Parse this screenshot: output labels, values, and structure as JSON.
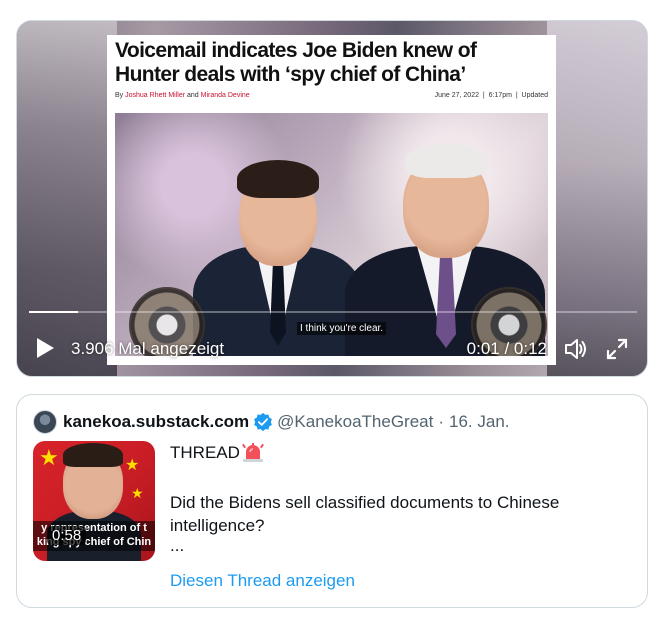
{
  "video": {
    "article": {
      "headline": "Voicemail indicates Joe Biden knew of Hunter deals with ‘spy chief of China’",
      "byline_prefix": "By",
      "author1": "Joshua Rhett Miller",
      "byline_and": "and",
      "author2": "Miranda Devine",
      "dateline": "June 27, 2022  |  6:17pm  |  Updated"
    },
    "caption": "I think you're clear.",
    "views": "3.906 Mal angezeigt",
    "time": "0:01 / 0:12",
    "progress": 0.08,
    "icons": [
      "play-icon",
      "volume-icon",
      "fullscreen-icon"
    ],
    "accent_color": "#ffffff"
  },
  "quote": {
    "name": "kanekoa.substack.com",
    "handle": "@KanekoaTheGreat",
    "separator": "·",
    "date": "16. Jan.",
    "thumbnail": {
      "banner": "y representation of t\nking spy chief of Chin",
      "duration": "0:58"
    },
    "title": "THREAD",
    "text": "Did the Bidens sell classified documents to Chinese intelligence?",
    "ellipsis": "...",
    "link": "Diesen Thread anzeigen",
    "link_color": "#1d9bf0",
    "verified_color": "#1d9bf0"
  }
}
